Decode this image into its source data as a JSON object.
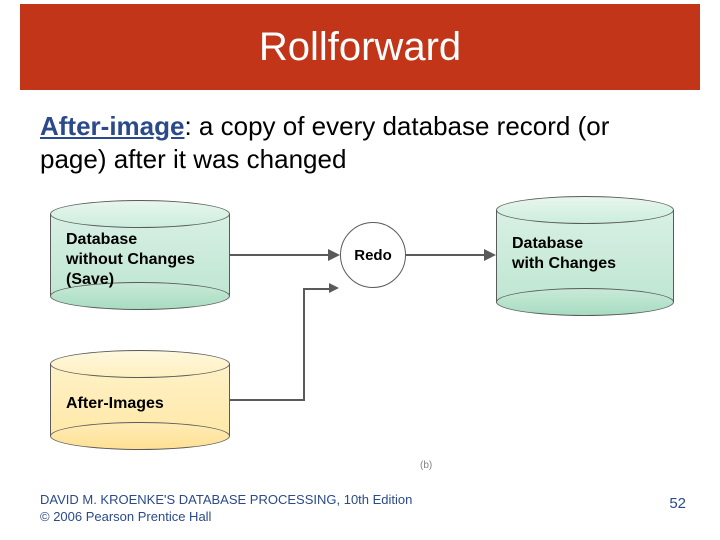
{
  "title": "Rollforward",
  "definition": {
    "term": "After-image",
    "body": ": a copy of every database record (or page) after it was changed"
  },
  "diagram": {
    "db_without": "Database\nwithout Changes\n(Save)",
    "after_images": "After-Images",
    "redo": "Redo",
    "db_with": "Database\nwith Changes",
    "caption": "(b)"
  },
  "footer": {
    "line1": "DAVID M. KROENKE'S DATABASE PROCESSING, 10th Edition",
    "line2": "© 2006 Pearson Prentice Hall"
  },
  "page_number": "52"
}
